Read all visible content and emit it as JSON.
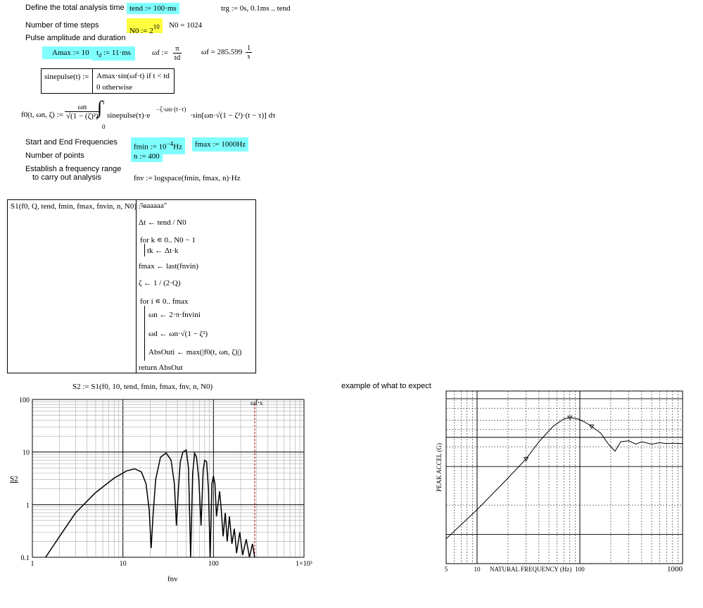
{
  "defs": {
    "tend_label": "Define the total analysis time",
    "tend_expr": "tend := 100·ms",
    "trg_expr": "trg := 0s, 0.1ms .. tend",
    "n0_label": "Number of time steps",
    "n0_expr_base": "N0 := 2",
    "n0_expr_exp": "10",
    "n0_result": "N0 = 1024",
    "pulse_label": "Pulse amplitude and duration",
    "amax_expr": "Amax := 10",
    "td_expr_base": "t",
    "td_expr_sub": "d",
    "td_expr_rest": " := 11·ms",
    "omega_f_lhs": "ωf :=",
    "omega_f_num": "π",
    "omega_f_den": "td",
    "omega_f_result": "ωf = 285.599",
    "omega_f_unit_num": "1",
    "omega_f_unit_den": "s"
  },
  "sinepulse": {
    "lhs": "sinepulse(t) :=",
    "line1": "Amax·sin(ωf·t)  if  t < td",
    "line2": "0  otherwise"
  },
  "f0": {
    "lhs": "f0(t, ωn, ζ) :=",
    "frac_num": "ωn",
    "frac_den": "√(1 − (ζ)²)",
    "integral_upper": "t",
    "integral_lower": "0",
    "integrand": "sinepulse(τ)·e",
    "exp": "−ζ·ωn·(t−τ)",
    "tail": "·sin[ωn·√(1 − ζ²)·(t − τ)] dτ"
  },
  "freq": {
    "range_label": "Start and End Frequencies",
    "fmin_expr": "fmin := 10",
    "fmin_exp": "−4",
    "fmin_unit": "Hz",
    "fmax_expr": "fmax := 1000Hz",
    "npts_label": "Number of points",
    "n_expr": "n := 400",
    "establish_label_1": "Establish a frequency range",
    "establish_label_2": "to carry out analysis",
    "fnv_expr": "fnv := logspace(fmin, fmax, n)·Hz"
  },
  "program": {
    "lhs": "S1(f0, Q, tend, fmin, fmax, fnvin, n, N0) :=",
    "lines": [
      "\"aaaaaa\"",
      "Δt ← tend / N0",
      "for  k ∊ 0.. N0 − 1",
      "tk ← Δt·k",
      "fmax ← last(fnvin)",
      "ζ ← 1 / (2·Q)",
      "for  i ∊ 0.. fmax",
      "ωn ← 2·π·fnvini",
      "ωd ← ωn·√(1 − ζ²)",
      "AbsOuti ← max(|f0(t, ωn, ζ)|)",
      "return  AbsOut"
    ]
  },
  "plot1": {
    "call_expr": "S2 := S1(f0, 10, tend, fmin, fmax, fnv, n, N0)",
    "ylabel": "S2",
    "xlabel": "fnv",
    "marker_label": "ωf·s",
    "y_ticks": [
      "100",
      "10",
      "1",
      "0.1"
    ],
    "x_ticks": [
      "1",
      "10",
      "100",
      "1×10³"
    ]
  },
  "plot2": {
    "caption": "example of what to expect",
    "ylabel": "PEAK ACCEL (G)",
    "xlabel": "NATURAL FREQUENCY (Hz)",
    "x_ticks": [
      "5",
      "10",
      "100",
      "1000"
    ]
  },
  "chart_data": [
    {
      "type": "line",
      "xscale": "log",
      "yscale": "log",
      "xlim": [
        1,
        1000
      ],
      "ylim": [
        0.1,
        100
      ],
      "xlabel": "fnv",
      "ylabel": "S2",
      "grid": true,
      "series": [
        {
          "x": [
            1.4,
            2,
            3,
            5,
            8,
            11,
            13.5,
            16,
            18,
            19.5,
            20.5,
            21.5,
            23,
            26,
            30,
            34,
            37,
            39,
            41,
            43,
            46,
            50,
            53,
            56,
            59,
            62,
            65,
            69,
            73,
            77,
            80,
            84,
            88,
            92,
            96,
            100,
            104,
            108,
            112,
            117,
            122,
            128,
            135,
            142,
            150,
            160,
            170,
            180,
            195,
            210,
            230,
            250,
            270,
            285
          ],
          "y": [
            0.1,
            0.25,
            0.7,
            1.7,
            3.2,
            4.4,
            4.8,
            4.2,
            2.5,
            0.8,
            0.15,
            0.6,
            3,
            8,
            9.6,
            7,
            2.5,
            0.4,
            2,
            6.5,
            10,
            11,
            5,
            0.1,
            4,
            9.5,
            8,
            3,
            0.4,
            4.5,
            7,
            6.5,
            2,
            0.1,
            2.5,
            3.5,
            2.5,
            0.6,
            1,
            1.8,
            0.8,
            0.25,
            0.7,
            0.2,
            0.6,
            0.18,
            0.35,
            0.12,
            0.3,
            0.11,
            0.22,
            0.1,
            0.18,
            0.1
          ]
        }
      ],
      "marker_x": 285.6
    },
    {
      "type": "line",
      "xscale": "log",
      "yscale": "log",
      "xlim": [
        5,
        1000
      ],
      "xlabel": "NATURAL FREQUENCY (Hz)",
      "ylabel": "PEAK ACCEL (G)",
      "grid": true,
      "series": [
        {
          "x": [
            5,
            10,
            20,
            30,
            40,
            55,
            70,
            80,
            95,
            110,
            130,
            160,
            190,
            220,
            250,
            300,
            350,
            400,
            500,
            600,
            700,
            800,
            1000
          ],
          "y": [
            0.09,
            0.18,
            0.38,
            0.6,
            0.9,
            1.3,
            1.55,
            1.6,
            1.55,
            1.45,
            1.3,
            1.1,
            0.85,
            0.72,
            0.9,
            0.92,
            0.85,
            0.9,
            0.85,
            0.88,
            0.86,
            0.87,
            0.86
          ]
        }
      ]
    }
  ]
}
